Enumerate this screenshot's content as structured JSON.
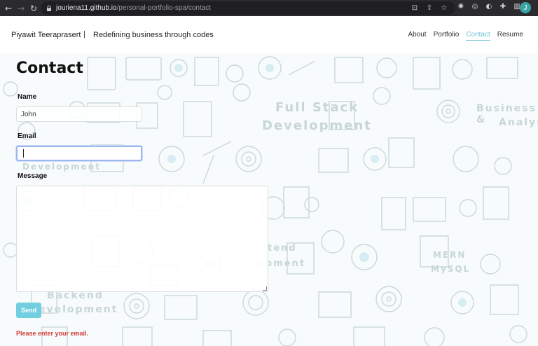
{
  "browser": {
    "url_host": "jouriena11.github.io",
    "url_path": "/personal-portfolio-spa/contact",
    "profile_initial": "J",
    "accent": "#3aa3a6"
  },
  "header": {
    "brand": "Piyawit Teeraprasert",
    "separator": "|",
    "tagline": "Redefining business through codes",
    "nav": [
      {
        "label": "About",
        "active": false
      },
      {
        "label": "Portfolio",
        "active": false
      },
      {
        "label": "Contact",
        "active": true
      },
      {
        "label": "Resume",
        "active": false
      }
    ],
    "active_color": "#6cc6d4"
  },
  "background": {
    "words": [
      "Full Stack",
      "Development",
      "Business &",
      "Analys",
      "Development",
      "tend",
      "opment",
      "MERN",
      "MySQL",
      "Backend",
      "evelopment"
    ]
  },
  "form": {
    "title": "Contact",
    "name_label": "Name",
    "name_value": "John",
    "email_label": "Email",
    "email_value": "",
    "message_label": "Message",
    "send_label": "Send",
    "error": "Please enter your email.",
    "button_color": "#72cfe0",
    "error_color": "#d03a3a"
  }
}
